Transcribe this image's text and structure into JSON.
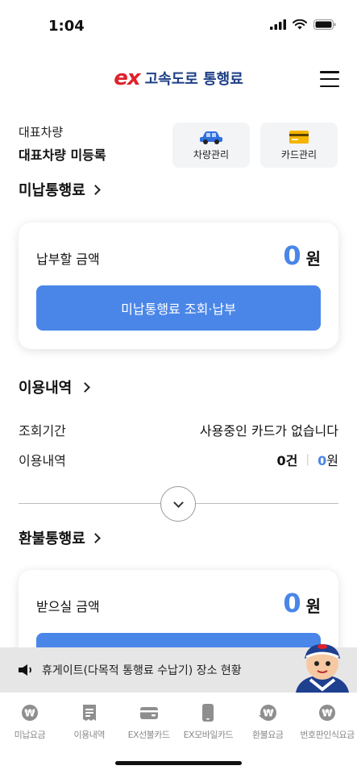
{
  "status_bar": {
    "time": "1:04"
  },
  "header": {
    "logo": "ex",
    "title": "고속도로 통행료"
  },
  "vehicle": {
    "label": "대표차량",
    "value": "대표차량 미등록",
    "car_button": "차량관리",
    "card_button": "카드관리"
  },
  "unpaid": {
    "heading": "미납통행료",
    "amount_label": "납부할 금액",
    "amount": "0",
    "unit": "원",
    "button": "미납통행료 조회·납부"
  },
  "usage": {
    "heading": "이용내역",
    "period_label": "조회기간",
    "period_value": "사용중인 카드가 없습니다",
    "history_label": "이용내역",
    "count": "0건",
    "separator": "|",
    "won_amount": "0",
    "won_unit": "원"
  },
  "refund": {
    "heading": "환불통행료",
    "amount_label": "받으실 금액",
    "amount": "0",
    "unit": "원"
  },
  "notice": {
    "text": "휴게이트(다목적 통행료 수납기) 장소 현황"
  },
  "bottom_nav": [
    {
      "label": "미납요금",
      "icon": "won-circle-icon"
    },
    {
      "label": "이용내역",
      "icon": "receipt-icon"
    },
    {
      "label": "EX선불카드",
      "icon": "wallet-icon"
    },
    {
      "label": "EX모바일카드",
      "icon": "phone-icon"
    },
    {
      "label": "환불요금",
      "icon": "won-refund-icon"
    },
    {
      "label": "번호판인식요금",
      "icon": "won-circle-icon"
    }
  ],
  "colors": {
    "accent": "#4a86e8",
    "brand_red": "#e0212b",
    "brand_navy": "#1e3f86"
  }
}
